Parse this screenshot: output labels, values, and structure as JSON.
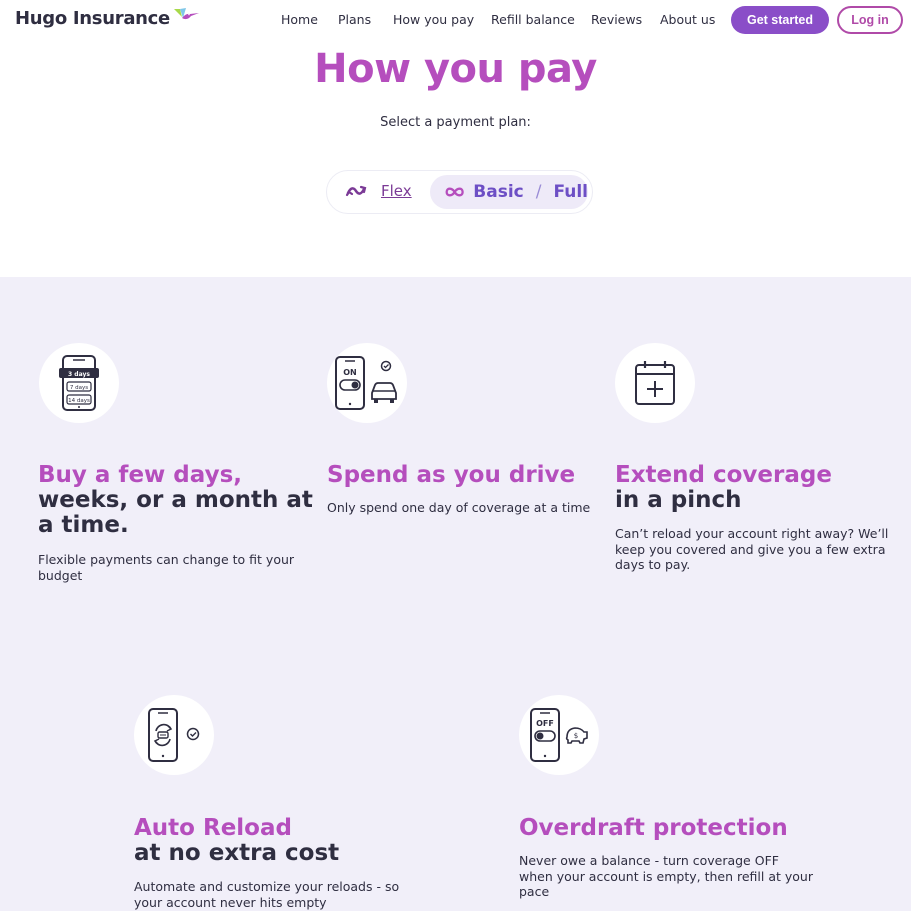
{
  "header": {
    "logo_text": "Hugo Insurance",
    "nav": [
      {
        "label": "Home"
      },
      {
        "label": "Plans"
      },
      {
        "label": "How you pay"
      },
      {
        "label": "Refill balance"
      },
      {
        "label": "Reviews"
      },
      {
        "label": "About us"
      }
    ],
    "cta_label": "Get started",
    "login_label": "Log in"
  },
  "hero": {
    "title": "How you pay",
    "prompt": "Select a payment plan:",
    "toggle": {
      "flex_label": "Flex",
      "basic_label": "Basic",
      "slash": "/",
      "full_label": "Full"
    }
  },
  "features": [
    {
      "title_accent": "Buy a few days,",
      "title_dark_1": "weeks, or a month at",
      "title_dark_2": "a time.",
      "desc_1": "Flexible payments can change to fit your",
      "desc_2": "budget",
      "icon_labels": [
        "3 days",
        "7 days",
        "14 days"
      ]
    },
    {
      "title_accent": "Spend as you drive",
      "desc_1": "Only spend one day of coverage at a time",
      "icon_label": "ON"
    },
    {
      "title_accent": "Extend coverage",
      "title_dark_1": "in a pinch",
      "desc_1": "Can’t reload your account right away? We’ll",
      "desc_2": "keep you covered and give you a few extra",
      "desc_3": "days to pay."
    },
    {
      "title_accent": "Auto Reload",
      "title_dark_1": "at no extra cost",
      "desc_1": "Automate and customize your reloads - so",
      "desc_2": "your account never hits empty"
    },
    {
      "title_accent": "Overdraft protection",
      "desc_1": "Never owe a balance - turn coverage OFF",
      "desc_2": "when your account is empty, then refill at your",
      "desc_3": "pace",
      "icon_label": "OFF"
    }
  ],
  "colors": {
    "accent": "#b54ebd",
    "button": "#8a4ec8",
    "text_dark": "#2f2e41",
    "section_bg": "#f1eff9"
  }
}
